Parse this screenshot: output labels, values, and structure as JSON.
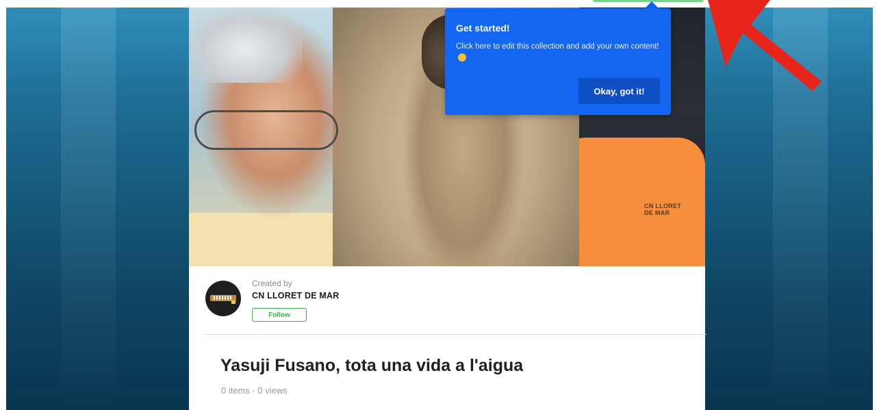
{
  "tooltip": {
    "title": "Get started!",
    "message": "Click here to edit this collection and add your own content!",
    "emoji": "grinning-face",
    "button": "Okay, got it!",
    "color": "#1466f2"
  },
  "hero": {
    "shirt_text": "CN LLORET DE MAR"
  },
  "creator": {
    "created_by_label": "Created by",
    "name": "CN LLORET DE MAR",
    "follow_label": "Follow"
  },
  "collection": {
    "title": "Yasuji Fusano, tota una vida a l'aigua",
    "items": "0 items",
    "separator": "·",
    "views": "0 views"
  },
  "annotation": {
    "arrow_color": "#e8251a"
  }
}
